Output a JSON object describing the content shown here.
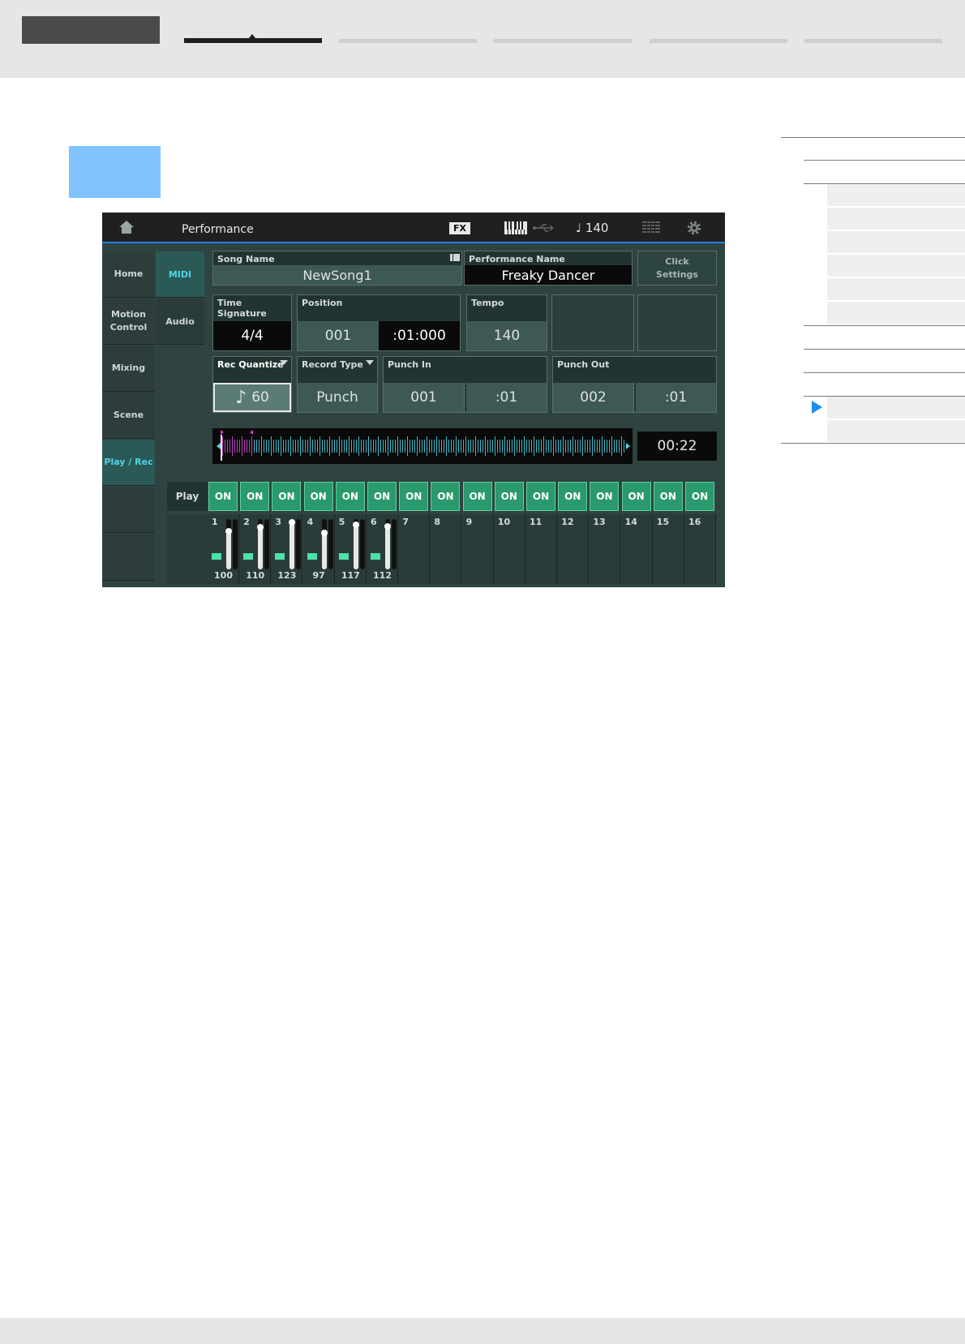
{
  "screen": {
    "title": "Performance",
    "fx_label": "FX",
    "tempo_display": "140",
    "nav": [
      "Home",
      "Motion Control",
      "Mixing",
      "Scene",
      "Play / Rec"
    ],
    "subnav": [
      "MIDI",
      "Audio"
    ],
    "song_name_label": "Song Name",
    "song_name": "NewSong1",
    "performance_name_label": "Performance Name",
    "performance_name": "Freaky Dancer",
    "click_settings": "Click Settings",
    "time_signature_label": "Time Signature",
    "time_signature": "4/4",
    "position_label": "Position",
    "position_measure": "001",
    "position_beat": ":01:000",
    "tempo_label": "Tempo",
    "tempo": "140",
    "rec_quantize_label": "Rec Quantize",
    "rec_quantize": "60",
    "record_type_label": "Record Type",
    "record_type": "Punch",
    "punch_in_label": "Punch In",
    "punch_in_measure": "001",
    "punch_in_beat": ":01",
    "punch_out_label": "Punch Out",
    "punch_out_measure": "002",
    "punch_out_beat": ":01",
    "time_display": "00:22",
    "play_label": "Play",
    "on_label": "ON",
    "track_numbers": [
      "1",
      "2",
      "3",
      "4",
      "5",
      "6",
      "7",
      "8",
      "9",
      "10",
      "11",
      "12",
      "13",
      "14",
      "15",
      "16"
    ],
    "track_volumes": [
      "100",
      "110",
      "123",
      "97",
      "117",
      "112"
    ],
    "track_levels": [
      0.79,
      0.87,
      0.97,
      0.76,
      0.92,
      0.88
    ]
  },
  "colors": {
    "accent": "#4fd3e8",
    "on": "#2a9a6c",
    "highlight": "#80c3ff",
    "toc_arrow": "#1a8ef0"
  }
}
